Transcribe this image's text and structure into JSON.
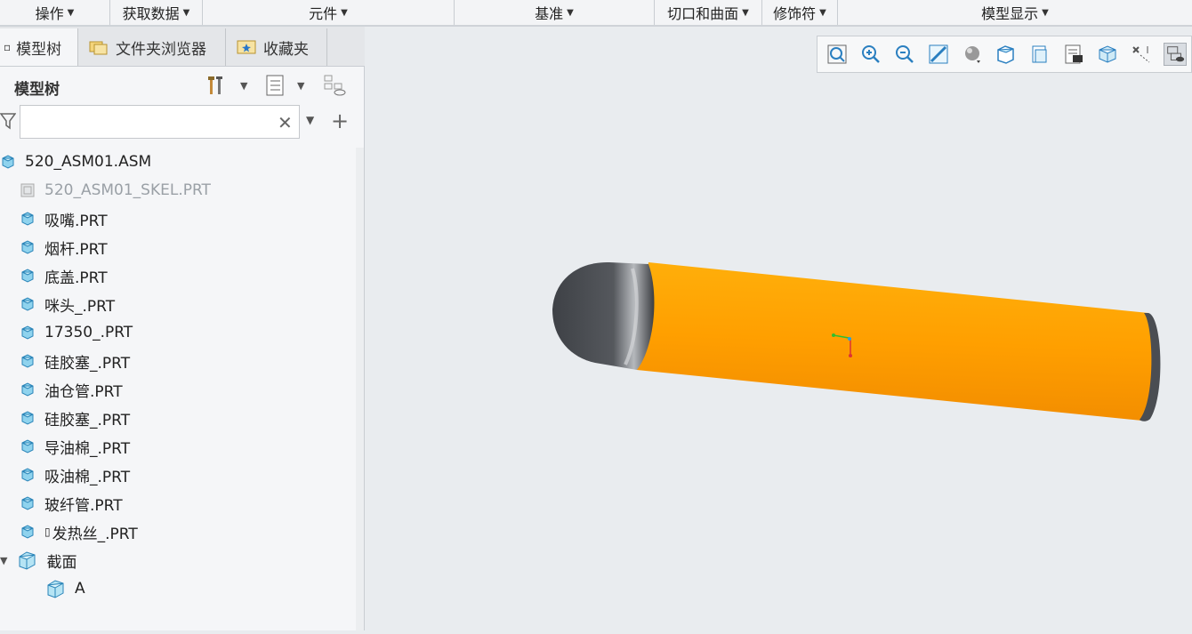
{
  "ribbon_groups": [
    {
      "label": "操作"
    },
    {
      "label": "获取数据"
    },
    {
      "label": "元件"
    },
    {
      "label": "基准"
    },
    {
      "label": "切口和曲面"
    },
    {
      "label": "修饰符"
    },
    {
      "label": "模型显示"
    }
  ],
  "tabs": [
    {
      "label": "模型树",
      "icon": "model-tree-icon"
    },
    {
      "label": "文件夹浏览器",
      "icon": "folder-browser-icon"
    },
    {
      "label": "收藏夹",
      "icon": "favorites-icon"
    }
  ],
  "tree_panel": {
    "title": "模型树",
    "header_icons": [
      "settings-tools-icon",
      "show-columns-icon",
      "hide-items-icon"
    ],
    "filter": {
      "value": "",
      "placeholder": ""
    }
  },
  "tree": {
    "root": {
      "label": "520_ASM01.ASM"
    },
    "items": [
      {
        "label": "520_ASM01_SKEL.PRT",
        "dim": true
      },
      {
        "label": "吸嘴.PRT"
      },
      {
        "label": "烟杆.PRT"
      },
      {
        "label": "底盖.PRT"
      },
      {
        "label": "咪头_.PRT"
      },
      {
        "label": "17350_.PRT"
      },
      {
        "label": "硅胶塞_.PRT"
      },
      {
        "label": "油仓管.PRT"
      },
      {
        "label": "硅胶塞_.PRT"
      },
      {
        "label": "导油棉_.PRT"
      },
      {
        "label": "吸油棉_.PRT"
      },
      {
        "label": "玻纤管.PRT"
      },
      {
        "label": "发热丝_.PRT"
      }
    ],
    "sections": {
      "label": "截面",
      "children": [
        {
          "label": "A"
        }
      ]
    }
  },
  "view_toolbar": [
    "refit-icon",
    "zoom-in-icon",
    "zoom-out-icon",
    "repaint-icon",
    "perspective-icon",
    "display-style-icon",
    "saved-orientations-icon",
    "view-manager-icon",
    "spin-center-icon",
    "annotation-display-icon",
    "section-display-icon"
  ],
  "colors": {
    "body": "#ff9e00",
    "cap": "#4a4d52",
    "accent": "#1f8fd6"
  }
}
